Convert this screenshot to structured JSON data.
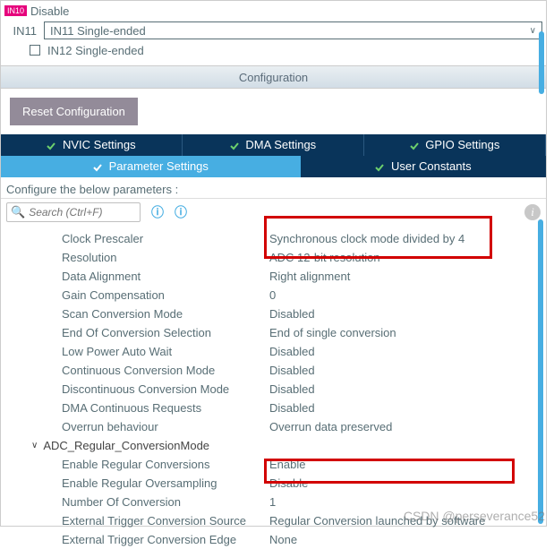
{
  "top": {
    "in10_tag": "IN10",
    "in10_txt": "Disable",
    "in11_label": "IN11",
    "in11_value": "IN11 Single-ended",
    "in12_label": "IN12 Single-ended"
  },
  "config_header": "Configuration",
  "reset_btn": "Reset Configuration",
  "tabs": {
    "nvic": "NVIC Settings",
    "dma": "DMA Settings",
    "gpio": "GPIO Settings",
    "param": "Parameter Settings",
    "user": "User Constants"
  },
  "config_label": "Configure the below parameters :",
  "search_placeholder": "Search (Ctrl+F)",
  "params": [
    {
      "name": "Clock Prescaler",
      "value": "Synchronous clock mode divided by 4"
    },
    {
      "name": "Resolution",
      "value": "ADC 12-bit resolution"
    },
    {
      "name": "Data Alignment",
      "value": "Right alignment"
    },
    {
      "name": "Gain Compensation",
      "value": "0"
    },
    {
      "name": "Scan Conversion Mode",
      "value": "Disabled"
    },
    {
      "name": "End Of Conversion Selection",
      "value": "End of single conversion"
    },
    {
      "name": "Low Power Auto Wait",
      "value": "Disabled"
    },
    {
      "name": "Continuous Conversion Mode",
      "value": "Disabled"
    },
    {
      "name": "Discontinuous Conversion Mode",
      "value": "Disabled"
    },
    {
      "name": "DMA Continuous Requests",
      "value": "Disabled"
    },
    {
      "name": "Overrun behaviour",
      "value": "Overrun data preserved"
    }
  ],
  "group2_label": "ADC_Regular_ConversionMode",
  "params2": [
    {
      "name": "Enable Regular Conversions",
      "value": "Enable"
    },
    {
      "name": "Enable Regular Oversampling",
      "value": "Disable"
    },
    {
      "name": "Number Of Conversion",
      "value": "1"
    },
    {
      "name": "External Trigger Conversion Source",
      "value": "Regular Conversion launched by software"
    },
    {
      "name": "External Trigger Conversion Edge",
      "value": "None"
    }
  ],
  "watermark": "CSDN @perseverance52"
}
